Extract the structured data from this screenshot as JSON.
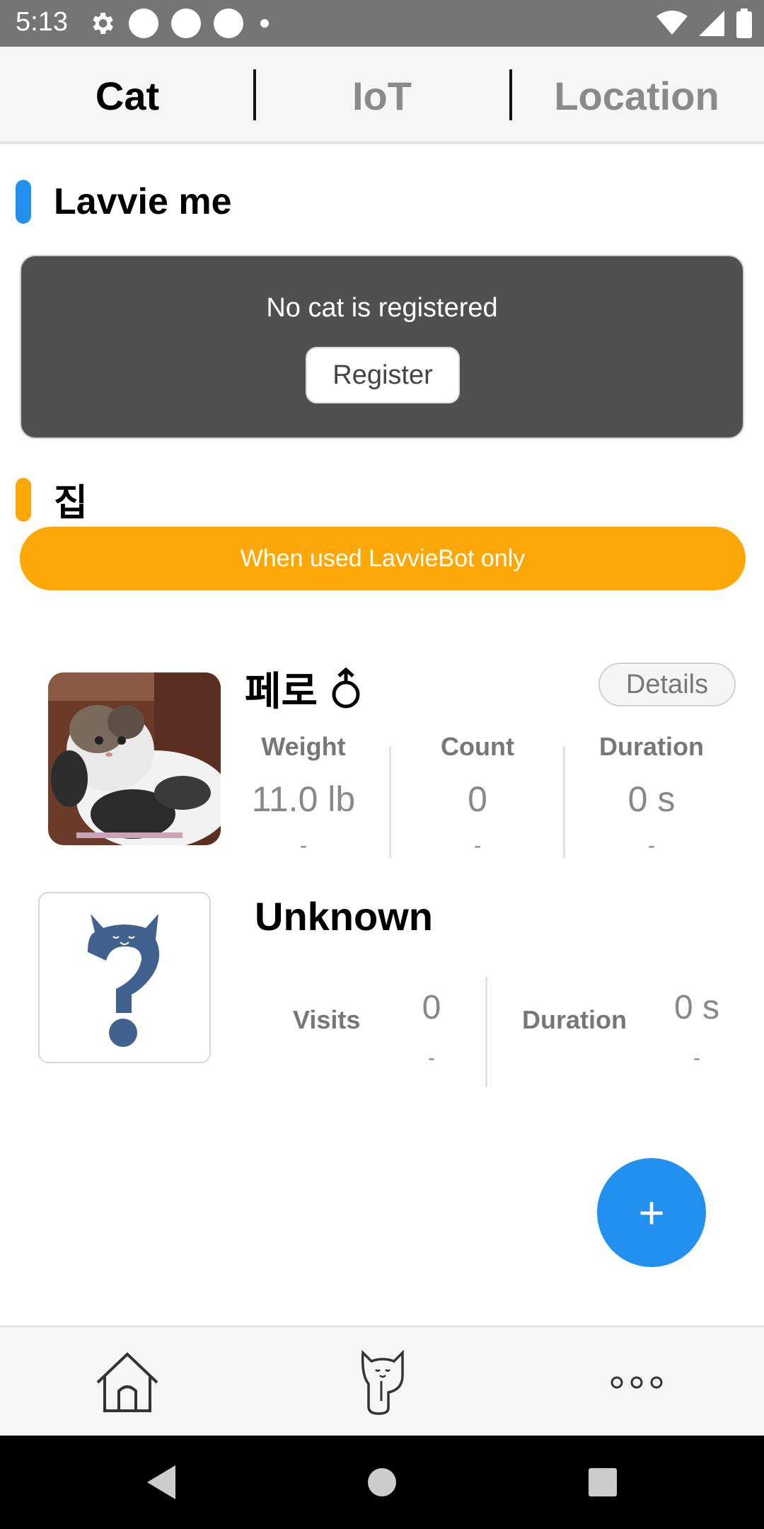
{
  "status_bar": {
    "time": "5:13",
    "left_icons": [
      "gear-icon",
      "circle-notification-icon",
      "circle-notification-icon",
      "circle-notification-icon",
      "dot-icon"
    ],
    "right_icons": [
      "wifi-icon",
      "signal-icon",
      "battery-icon"
    ]
  },
  "tabs": [
    {
      "label": "Cat",
      "active": true
    },
    {
      "label": "IoT",
      "active": false
    },
    {
      "label": "Location",
      "active": false
    }
  ],
  "sections": {
    "lavvie_me": {
      "title": "Lavvie me",
      "accent": "#2290ee",
      "empty_text": "No cat is registered",
      "register_label": "Register"
    },
    "home": {
      "title": "집",
      "accent": "#fea807",
      "banner": "When used LavvieBot only"
    }
  },
  "cat": {
    "name": "페로",
    "gender_icon": "male-symbol-icon",
    "details_label": "Details",
    "stats": [
      {
        "label": "Weight",
        "value": "11.0 lb",
        "sub": "-"
      },
      {
        "label": "Count",
        "value": "0",
        "sub": "-"
      },
      {
        "label": "Duration",
        "value": "0 s",
        "sub": "-"
      }
    ]
  },
  "unknown": {
    "title": "Unknown",
    "visits_label": "Visits",
    "visits_value": "0",
    "visits_sub": "-",
    "duration_label": "Duration",
    "duration_value": "0 s",
    "duration_sub": "-"
  },
  "fab": {
    "label": "+",
    "accent": "#2290ee"
  },
  "bottom_nav": [
    "home-icon",
    "cat-icon",
    "more-icon"
  ],
  "android_nav": [
    "back-icon",
    "home-circle-icon",
    "recents-icon"
  ]
}
